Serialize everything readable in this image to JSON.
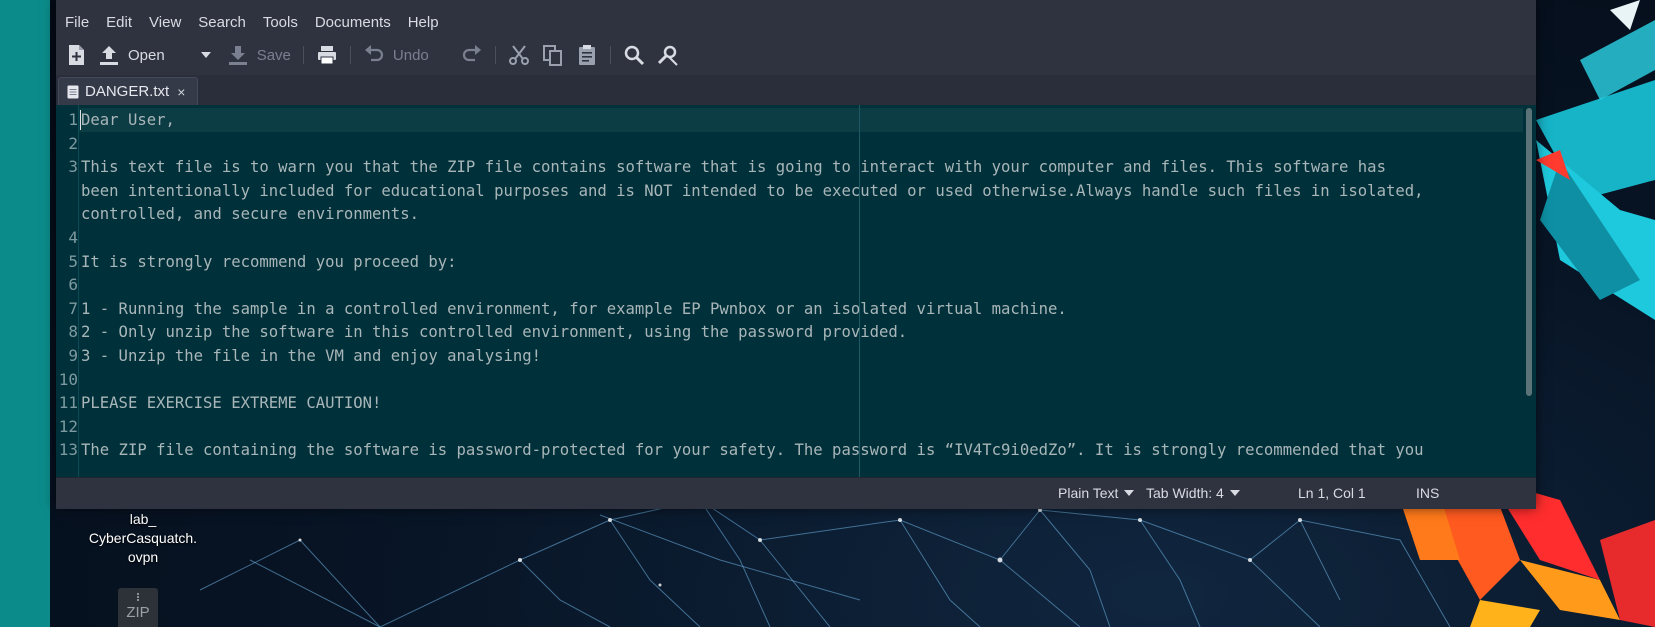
{
  "window": {
    "menu": [
      "File",
      "Edit",
      "View",
      "Search",
      "Tools",
      "Documents",
      "Help"
    ],
    "toolbar": {
      "new_icon": "new-document-icon",
      "open_label": "Open",
      "open_icon": "upload-arrow-icon",
      "save_label": "Save",
      "save_icon": "download-arrow-icon",
      "undo_label": "Undo",
      "undo_icon": "undo-icon",
      "redo_icon": "redo-icon"
    },
    "tab": {
      "filename": "DANGER.txt",
      "close": "×"
    },
    "lines": [
      {
        "n": "1",
        "text": "Dear User,"
      },
      {
        "n": "2",
        "text": ""
      },
      {
        "n": "3",
        "text": "This text file is to warn you that the ZIP file contains software that is going to interact with your computer and files. This software has"
      },
      {
        "n": "",
        "text": "been intentionally included for educational purposes and is NOT intended to be executed or used otherwise.Always handle such files in isolated,"
      },
      {
        "n": "",
        "text": "controlled, and secure environments."
      },
      {
        "n": "4",
        "text": ""
      },
      {
        "n": "5",
        "text": "It is strongly recommend you proceed by:"
      },
      {
        "n": "6",
        "text": ""
      },
      {
        "n": "7",
        "text": "1 - Running the sample in a controlled environment, for example EP Pwnbox or an isolated virtual machine."
      },
      {
        "n": "8",
        "text": "2 - Only unzip the software in this controlled environment, using the password provided."
      },
      {
        "n": "9",
        "text": "3 - Unzip the file in the VM and enjoy analysing!"
      },
      {
        "n": "10",
        "text": ""
      },
      {
        "n": "11",
        "text": "PLEASE EXERCISE EXTREME CAUTION!"
      },
      {
        "n": "12",
        "text": ""
      },
      {
        "n": "13",
        "text": "The ZIP file containing the software is password-protected for your safety. The password is “IV4Tc9i0edZo”. It is strongly recommended that you"
      }
    ],
    "status": {
      "language": "Plain Text",
      "tab_width": "Tab Width:  4",
      "position": "Ln 1, Col 1",
      "mode": "INS"
    }
  },
  "desktop": {
    "file_icon_label": [
      "lab_",
      "CyberCasquatch.",
      "ovpn"
    ],
    "zip_label": "ZIP"
  }
}
